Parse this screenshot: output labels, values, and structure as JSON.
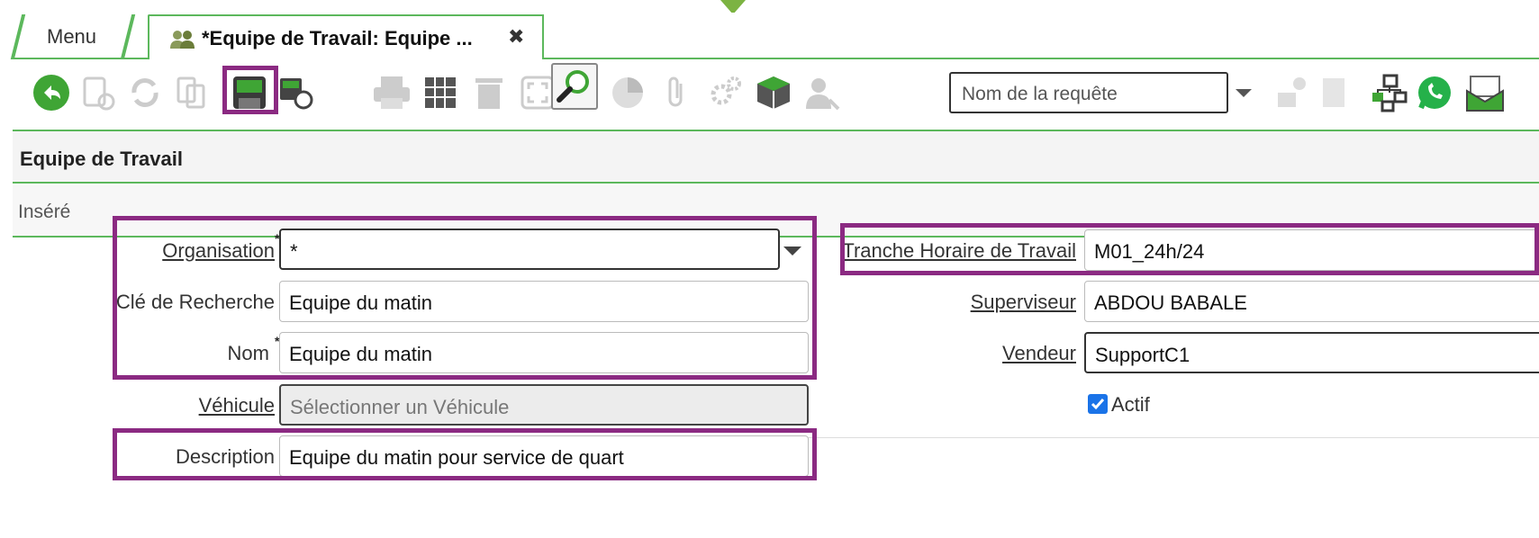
{
  "tabs": {
    "menu_label": "Menu",
    "active_label": "*Equipe de Travail: Equipe ...",
    "close_symbol": "✖"
  },
  "toolbar": {
    "icons": [
      "undo-icon",
      "new-record-icon",
      "refresh-icon",
      "copy-icon",
      "save-icon",
      "save-new-icon",
      "print-icon",
      "grid-icon",
      "delete-icon",
      "fullscreen-icon",
      "find-icon",
      "chart-icon",
      "attachment-icon",
      "process-icon",
      "package-icon",
      "user-role-icon"
    ],
    "query_placeholder": "Nom de la requête",
    "right_icons": [
      "send-mail-icon",
      "document-icon",
      "network-icon",
      "whatsapp-icon",
      "email-icon"
    ]
  },
  "section": {
    "title": "Equipe de Travail",
    "status": "Inséré"
  },
  "form": {
    "organisation_label": "Organisation",
    "organisation_value": "*",
    "search_key_label": "Clé de Recherche",
    "search_key_value": "Equipe du matin",
    "name_label": "Nom",
    "name_value": "Equipe du matin",
    "vehicle_label": "Véhicule",
    "vehicle_placeholder": "Sélectionner un Véhicule",
    "description_label": "Description",
    "description_value": "Equipe du matin pour service de quart",
    "schedule_label": "Tranche Horaire de Travail",
    "schedule_value": "M01_24h/24",
    "supervisor_label": "Superviseur",
    "supervisor_value": "ABDOU BABALE",
    "seller_label": "Vendeur",
    "seller_value": "SupportC1",
    "active_label": "Actif",
    "required_mark": "*"
  },
  "colors": {
    "accent_green": "#5cb85c",
    "highlight_purple": "#8b2a82",
    "checkbox_blue": "#1a73e8"
  }
}
